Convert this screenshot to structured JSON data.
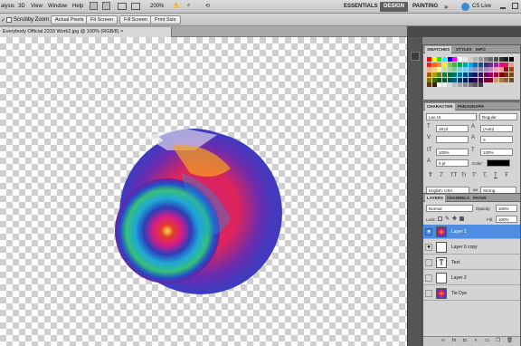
{
  "menubar": {
    "items": [
      "alysis",
      "3D",
      "View",
      "Window",
      "Help"
    ],
    "zoom": "200%",
    "workspaces": [
      {
        "label": "ESSENTIALS",
        "active": false
      },
      {
        "label": "DESIGN",
        "active": true
      },
      {
        "label": "PAINTING",
        "active": false
      }
    ],
    "more": "»",
    "cs_live": "CS Live"
  },
  "options": {
    "scrubby_zoom": "Scrubby Zoom",
    "actual_pixels": "Actual Pixels",
    "fit_screen": "Fit Screen",
    "fill_screen": "Fill Screen",
    "print_size": "Print Size"
  },
  "document": {
    "side_label": "RGB/8) ×",
    "tab_title": "Everybody Official 2333 Work2.jpg @ 100% (RGB/8) ×"
  },
  "swatches": {
    "tabs": [
      {
        "label": "SWATCHES",
        "active": true
      },
      {
        "label": "STYLES",
        "active": false
      },
      {
        "label": "INFO",
        "active": false
      }
    ],
    "colors": [
      "#ff0000",
      "#ffff00",
      "#00ff00",
      "#00ffff",
      "#0000ff",
      "#ff00ff",
      "#ffffff",
      "#e6e6e6",
      "#cccccc",
      "#b3b3b3",
      "#999999",
      "#808080",
      "#666666",
      "#4d4d4d",
      "#333333",
      "#1a1a1a",
      "#000000",
      "#ee1d24",
      "#f26522",
      "#f7941d",
      "#fff200",
      "#8dc63f",
      "#39b54a",
      "#00a651",
      "#00a99d",
      "#00aeef",
      "#0072bc",
      "#0054a6",
      "#2e3192",
      "#662d91",
      "#92278f",
      "#ec008c",
      "#ed145b",
      "#f69679",
      "#f9ad81",
      "#fdc689",
      "#fff799",
      "#c4df9b",
      "#a3d39c",
      "#82ca9c",
      "#7accc8",
      "#6dcff6",
      "#7da7d9",
      "#8393ca",
      "#8781bd",
      "#a186be",
      "#bd8cbf",
      "#f49ac1",
      "#f5989d",
      "#9e0b0f",
      "#a0410d",
      "#a36209",
      "#aba000",
      "#598527",
      "#1a7b30",
      "#007236",
      "#00746b",
      "#0076a3",
      "#004b80",
      "#003471",
      "#1b1464",
      "#440e62",
      "#630460",
      "#9e005d",
      "#9e0039",
      "#790000",
      "#7b2e00",
      "#7d4900",
      "#827b00",
      "#406618",
      "#005e20",
      "#005826",
      "#005952",
      "#005b7f",
      "#003663",
      "#002157",
      "#0d004c",
      "#32004b",
      "#4b0049",
      "#7b0046",
      "#7a0026",
      "#c69c6d",
      "#a67c52",
      "#8c6239",
      "#754c24",
      "#603913",
      "#42210b",
      "#ffffff",
      "#f2f2f2",
      "#d9d9d9",
      "#bfbfbf",
      "#a6a6a6",
      "#8c8c8c",
      "#737373",
      "#595959",
      "#404040"
    ]
  },
  "character": {
    "tabs": [
      {
        "label": "CHARACTER",
        "active": true
      },
      {
        "label": "PARAGRAPH",
        "active": false
      }
    ],
    "font_family": "Lao UI",
    "font_style": "Regular",
    "font_size": "18 pt",
    "leading": "(Auto)",
    "kerning": "",
    "tracking": "0",
    "vscale": "100%",
    "hscale": "100%",
    "baseline": "0 pt",
    "color_label": "Color:",
    "style_buttons": [
      "T",
      "T",
      "TT",
      "Tr",
      "T'",
      "T,",
      "T",
      "Ŧ"
    ],
    "language": "English: USA",
    "aa_icon": "aa",
    "antialias": "Strong"
  },
  "layers": {
    "tabs": [
      {
        "label": "LAYERS",
        "active": true
      },
      {
        "label": "CHANNELS",
        "active": false
      },
      {
        "label": "PATHS",
        "active": false
      }
    ],
    "blend_mode": "Normal",
    "opacity_label": "Opacity:",
    "opacity": "100%",
    "lock_label": "Lock:",
    "fill_label": "Fill:",
    "fill": "100%",
    "items": [
      {
        "name": "Layer 1",
        "visible": true,
        "selected": true
      },
      {
        "name": "Layer 0 copy",
        "visible": true,
        "selected": false
      },
      {
        "name": "Text",
        "visible": false,
        "selected": false
      },
      {
        "name": "Layer 2",
        "visible": false,
        "selected": false
      },
      {
        "name": "Tie Dye",
        "visible": false,
        "selected": false
      }
    ],
    "footer_icons": [
      "link-icon",
      "fx-icon",
      "mask-icon",
      "adjustment-icon",
      "folder-icon",
      "new-layer-icon",
      "trash-icon"
    ]
  }
}
